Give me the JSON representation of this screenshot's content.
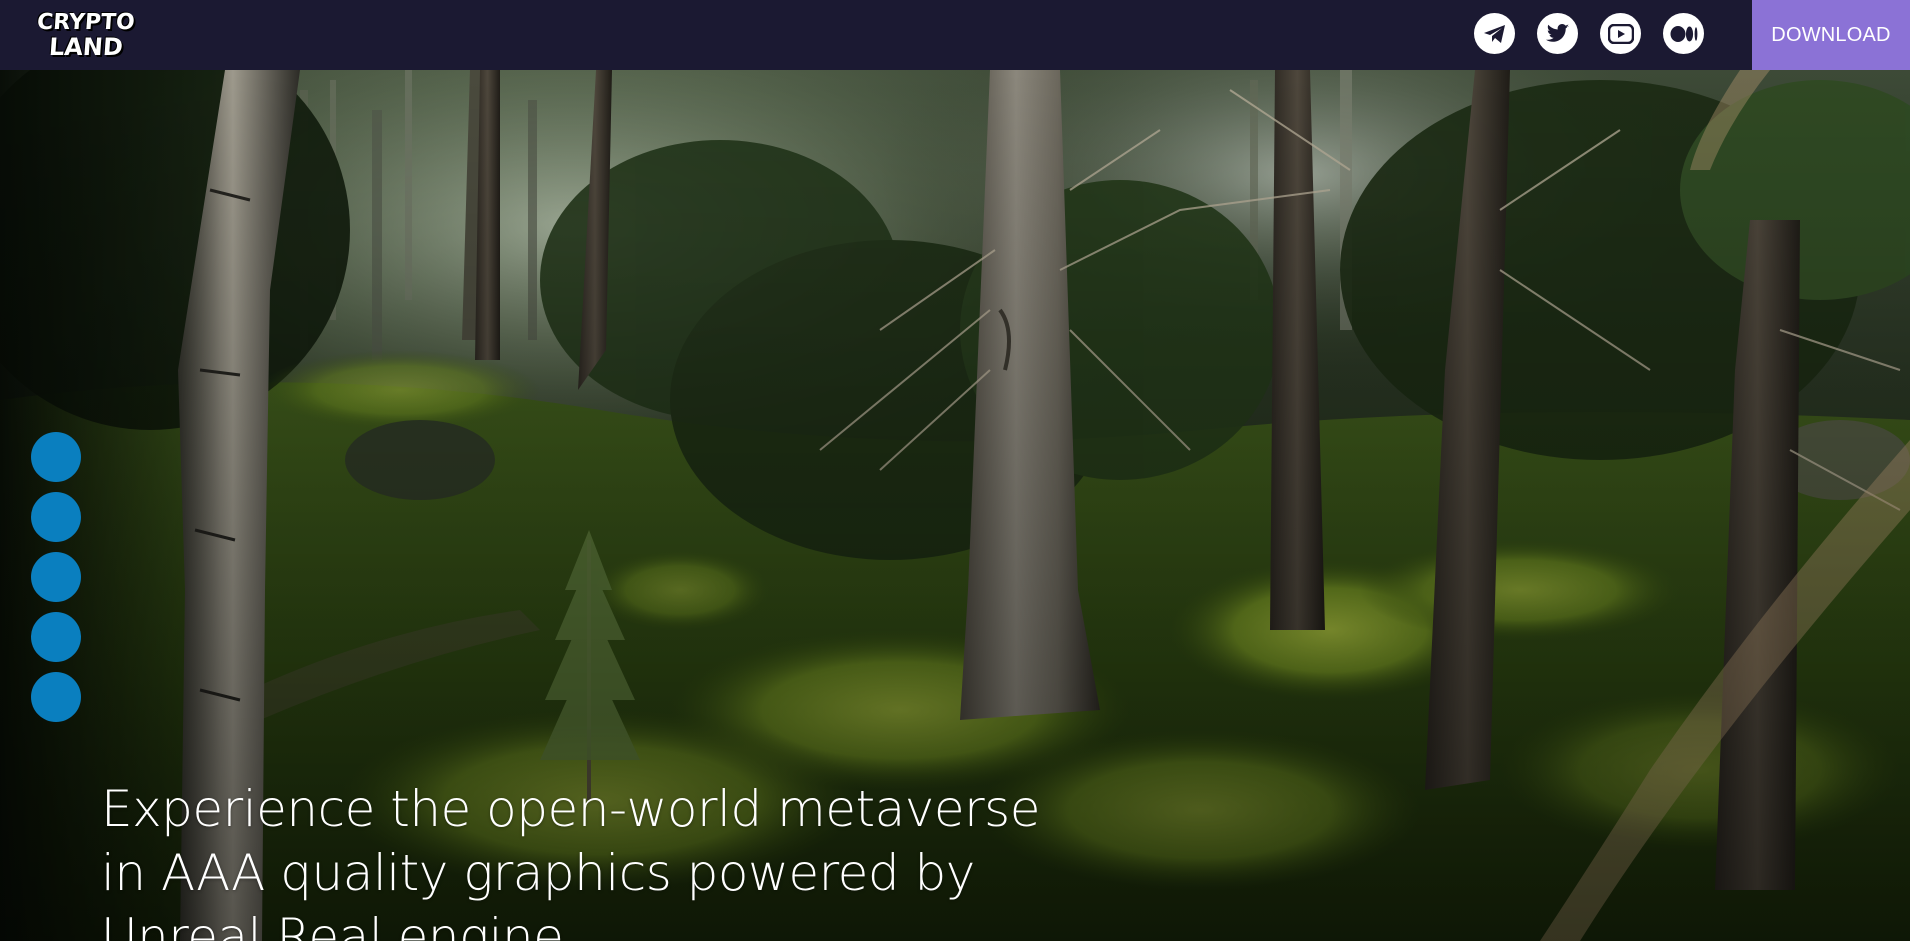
{
  "header": {
    "logo_line1": "CRYPTO",
    "logo_line2": "LAND",
    "socials": [
      {
        "name": "telegram",
        "icon": "telegram-icon"
      },
      {
        "name": "twitter",
        "icon": "twitter-icon"
      },
      {
        "name": "youtube",
        "icon": "youtube-icon"
      },
      {
        "name": "medium",
        "icon": "medium-icon"
      }
    ],
    "download_label": "DOWNLOAD"
  },
  "hero": {
    "headline_lines": [
      "Experience the open-world metaverse",
      "in AAA quality graphics powered by",
      "Unreal Real engine"
    ]
  },
  "slider": {
    "dot_count": 5
  },
  "colors": {
    "header_bg": "#1b1932",
    "download_bg": "#8b72d6",
    "dot": "#0a7fbf",
    "text": "#ffffff"
  }
}
